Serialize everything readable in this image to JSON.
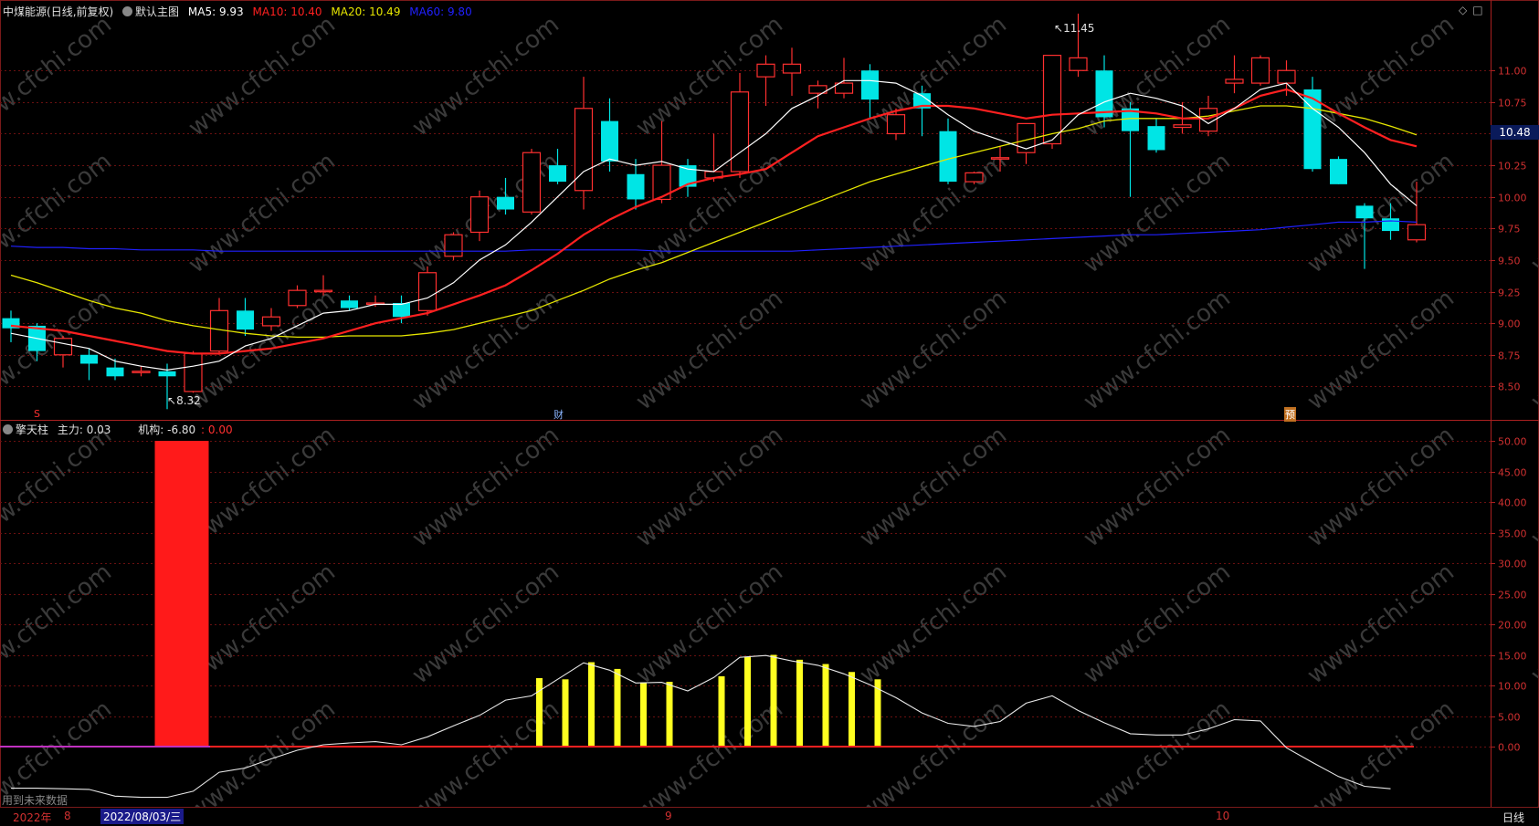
{
  "header": {
    "stock": "中煤能源",
    "mode": "(日线,前复权)",
    "main_chart": "默认主图",
    "ma5_label": "MA5:",
    "ma5": "9.93",
    "ma10_label": "MA10:",
    "ma10": "10.40",
    "ma20_label": "MA20:",
    "ma20": "10.49",
    "ma60_label": "MA60:",
    "ma60": "9.80",
    "colors": {
      "ma5": "#ffffff",
      "ma10": "#ff2020",
      "ma20": "#e6e600",
      "ma60": "#2020ff"
    }
  },
  "sub_header": {
    "indicator": "擎天柱",
    "main_force_label": "主力:",
    "main_force": "0.03",
    "inst_label": "机构:",
    "inst": "-6.80",
    "extra": ": 0.00"
  },
  "markers": {
    "high": "11.45",
    "low": "8.32",
    "ex_div": "S",
    "finance": "财",
    "forecast": "预"
  },
  "current_price": "10.48",
  "bottom_bar": {
    "year": "2022年",
    "date_cursor": "2022/08/03/三",
    "months": [
      "8",
      "9",
      "10"
    ],
    "period": "日线",
    "future_data": "用到未来数据"
  },
  "watermark": "www.cfchi.com",
  "chart_data": [
    {
      "type": "candlestick",
      "title": "中煤能源 (日线,前复权)",
      "ylim": [
        8.25,
        11.5
      ],
      "yticks": [
        8.5,
        8.75,
        9.0,
        9.25,
        9.5,
        9.75,
        10.0,
        10.25,
        10.5,
        10.75,
        11.0
      ],
      "grid": true,
      "candles": [
        {
          "o": 9.04,
          "h": 9.1,
          "l": 8.85,
          "c": 8.96
        },
        {
          "o": 8.98,
          "h": 9.0,
          "l": 8.7,
          "c": 8.78
        },
        {
          "o": 8.75,
          "h": 8.9,
          "l": 8.65,
          "c": 8.88
        },
        {
          "o": 8.75,
          "h": 8.8,
          "l": 8.55,
          "c": 8.68
        },
        {
          "o": 8.65,
          "h": 8.72,
          "l": 8.55,
          "c": 8.58
        },
        {
          "o": 8.62,
          "h": 8.66,
          "l": 8.58,
          "c": 8.62
        },
        {
          "o": 8.62,
          "h": 8.68,
          "l": 8.32,
          "c": 8.58
        },
        {
          "o": 8.46,
          "h": 8.78,
          "l": 8.45,
          "c": 8.76
        },
        {
          "o": 8.78,
          "h": 9.2,
          "l": 8.75,
          "c": 9.1
        },
        {
          "o": 9.1,
          "h": 9.2,
          "l": 8.9,
          "c": 8.95
        },
        {
          "o": 8.98,
          "h": 9.12,
          "l": 8.94,
          "c": 9.05
        },
        {
          "o": 9.14,
          "h": 9.3,
          "l": 9.12,
          "c": 9.26
        },
        {
          "o": 9.26,
          "h": 9.38,
          "l": 9.22,
          "c": 9.26
        },
        {
          "o": 9.18,
          "h": 9.22,
          "l": 9.1,
          "c": 9.12
        },
        {
          "o": 9.16,
          "h": 9.22,
          "l": 9.13,
          "c": 9.16
        },
        {
          "o": 9.16,
          "h": 9.22,
          "l": 9.0,
          "c": 9.05
        },
        {
          "o": 9.1,
          "h": 9.45,
          "l": 9.06,
          "c": 9.4
        },
        {
          "o": 9.53,
          "h": 9.72,
          "l": 9.5,
          "c": 9.7
        },
        {
          "o": 9.72,
          "h": 10.05,
          "l": 9.65,
          "c": 10.0
        },
        {
          "o": 10.0,
          "h": 10.15,
          "l": 9.86,
          "c": 9.9
        },
        {
          "o": 9.88,
          "h": 10.38,
          "l": 9.86,
          "c": 10.35
        },
        {
          "o": 10.25,
          "h": 10.38,
          "l": 10.1,
          "c": 10.12
        },
        {
          "o": 10.05,
          "h": 10.95,
          "l": 9.9,
          "c": 10.7
        },
        {
          "o": 10.6,
          "h": 10.78,
          "l": 10.2,
          "c": 10.28
        },
        {
          "o": 10.18,
          "h": 10.3,
          "l": 9.9,
          "c": 9.98
        },
        {
          "o": 9.98,
          "h": 10.6,
          "l": 9.95,
          "c": 10.25
        },
        {
          "o": 10.25,
          "h": 10.3,
          "l": 10.0,
          "c": 10.08
        },
        {
          "o": 10.15,
          "h": 10.5,
          "l": 10.12,
          "c": 10.2
        },
        {
          "o": 10.2,
          "h": 10.98,
          "l": 10.15,
          "c": 10.83
        },
        {
          "o": 10.95,
          "h": 11.12,
          "l": 10.72,
          "c": 11.05
        },
        {
          "o": 10.98,
          "h": 11.18,
          "l": 10.8,
          "c": 11.05
        },
        {
          "o": 10.82,
          "h": 10.92,
          "l": 10.7,
          "c": 10.88
        },
        {
          "o": 10.82,
          "h": 11.1,
          "l": 10.78,
          "c": 10.9
        },
        {
          "o": 11.0,
          "h": 11.05,
          "l": 10.62,
          "c": 10.77
        },
        {
          "o": 10.5,
          "h": 10.7,
          "l": 10.45,
          "c": 10.65
        },
        {
          "o": 10.82,
          "h": 10.88,
          "l": 10.48,
          "c": 10.7
        },
        {
          "o": 10.52,
          "h": 10.62,
          "l": 10.1,
          "c": 10.12
        },
        {
          "o": 10.12,
          "h": 10.2,
          "l": 10.1,
          "c": 10.19
        },
        {
          "o": 10.3,
          "h": 10.4,
          "l": 10.2,
          "c": 10.31
        },
        {
          "o": 10.35,
          "h": 10.55,
          "l": 10.26,
          "c": 10.58
        },
        {
          "o": 10.42,
          "h": 11.12,
          "l": 10.38,
          "c": 11.12
        },
        {
          "o": 11.0,
          "h": 11.45,
          "l": 10.95,
          "c": 11.1
        },
        {
          "o": 11.0,
          "h": 11.12,
          "l": 10.55,
          "c": 10.63
        },
        {
          "o": 10.7,
          "h": 10.75,
          "l": 10.0,
          "c": 10.52
        },
        {
          "o": 10.56,
          "h": 10.62,
          "l": 10.35,
          "c": 10.37
        },
        {
          "o": 10.55,
          "h": 10.75,
          "l": 10.5,
          "c": 10.57
        },
        {
          "o": 10.52,
          "h": 10.8,
          "l": 10.48,
          "c": 10.7
        },
        {
          "o": 10.9,
          "h": 11.12,
          "l": 10.82,
          "c": 10.93
        },
        {
          "o": 10.9,
          "h": 11.12,
          "l": 10.88,
          "c": 11.1
        },
        {
          "o": 10.9,
          "h": 11.08,
          "l": 10.8,
          "c": 11.0
        },
        {
          "o": 10.85,
          "h": 10.95,
          "l": 10.2,
          "c": 10.22
        },
        {
          "o": 10.3,
          "h": 10.32,
          "l": 10.1,
          "c": 10.1
        },
        {
          "o": 9.93,
          "h": 9.95,
          "l": 9.43,
          "c": 9.83
        },
        {
          "o": 9.83,
          "h": 9.95,
          "l": 9.66,
          "c": 9.73
        },
        {
          "o": 9.66,
          "h": 10.12,
          "l": 9.64,
          "c": 9.78
        }
      ],
      "ma5": [
        8.92,
        8.88,
        8.84,
        8.8,
        8.7,
        8.66,
        8.63,
        8.66,
        8.7,
        8.82,
        8.88,
        8.98,
        9.08,
        9.1,
        9.15,
        9.15,
        9.2,
        9.32,
        9.5,
        9.62,
        9.8,
        10.0,
        10.2,
        10.3,
        10.25,
        10.28,
        10.22,
        10.2,
        10.35,
        10.5,
        10.7,
        10.8,
        10.92,
        10.92,
        10.9,
        10.8,
        10.65,
        10.52,
        10.45,
        10.38,
        10.45,
        10.65,
        10.75,
        10.82,
        10.78,
        10.72,
        10.58,
        10.7,
        10.85,
        10.9,
        10.7,
        10.55,
        10.35,
        10.1,
        9.93
      ],
      "ma10": [
        8.98,
        8.96,
        8.94,
        8.9,
        8.86,
        8.82,
        8.78,
        8.76,
        8.76,
        8.78,
        8.8,
        8.84,
        8.88,
        8.94,
        9.0,
        9.04,
        9.08,
        9.15,
        9.22,
        9.3,
        9.42,
        9.55,
        9.7,
        9.82,
        9.92,
        10.0,
        10.1,
        10.15,
        10.18,
        10.22,
        10.35,
        10.48,
        10.55,
        10.62,
        10.68,
        10.72,
        10.72,
        10.7,
        10.66,
        10.62,
        10.65,
        10.66,
        10.67,
        10.68,
        10.66,
        10.62,
        10.62,
        10.7,
        10.8,
        10.85,
        10.78,
        10.66,
        10.55,
        10.45,
        10.4
      ],
      "ma20": [
        9.38,
        9.32,
        9.25,
        9.18,
        9.12,
        9.08,
        9.02,
        8.98,
        8.95,
        8.92,
        8.9,
        8.89,
        8.89,
        8.9,
        8.9,
        8.9,
        8.92,
        8.95,
        9.0,
        9.05,
        9.1,
        9.18,
        9.26,
        9.35,
        9.42,
        9.48,
        9.56,
        9.64,
        9.72,
        9.8,
        9.88,
        9.96,
        10.04,
        10.12,
        10.18,
        10.24,
        10.3,
        10.35,
        10.4,
        10.45,
        10.5,
        10.54,
        10.6,
        10.62,
        10.62,
        10.62,
        10.64,
        10.68,
        10.72,
        10.72,
        10.7,
        10.66,
        10.62,
        10.56,
        10.49
      ],
      "ma60": [
        9.61,
        9.6,
        9.6,
        9.59,
        9.59,
        9.58,
        9.58,
        9.58,
        9.57,
        9.57,
        9.57,
        9.57,
        9.57,
        9.57,
        9.57,
        9.57,
        9.57,
        9.57,
        9.57,
        9.57,
        9.58,
        9.58,
        9.58,
        9.58,
        9.58,
        9.57,
        9.57,
        9.57,
        9.57,
        9.57,
        9.57,
        9.58,
        9.59,
        9.6,
        9.61,
        9.62,
        9.63,
        9.64,
        9.65,
        9.66,
        9.67,
        9.68,
        9.69,
        9.7,
        9.7,
        9.71,
        9.72,
        9.73,
        9.74,
        9.76,
        9.78,
        9.8,
        9.8,
        9.81,
        9.8
      ]
    },
    {
      "type": "bar",
      "title": "擎天柱",
      "ylim": [
        -7.0,
        50.0
      ],
      "yticks": [
        0.0,
        5.0,
        10.0,
        15.0,
        20.0,
        25.0,
        30.0,
        35.0,
        40.0,
        45.0,
        50.0
      ],
      "grid": true,
      "red_bar": {
        "index": 6,
        "span": 2,
        "value": 50.0
      },
      "yellow_bars": [
        {
          "index": 20,
          "value": 11.2
        },
        {
          "index": 21,
          "value": 11.0
        },
        {
          "index": 22,
          "value": 13.8
        },
        {
          "index": 23,
          "value": 12.7
        },
        {
          "index": 24,
          "value": 10.5
        },
        {
          "index": 25,
          "value": 10.6
        },
        {
          "index": 27,
          "value": 11.5
        },
        {
          "index": 28,
          "value": 14.7
        },
        {
          "index": 29,
          "value": 15.0
        },
        {
          "index": 30,
          "value": 14.2
        },
        {
          "index": 31,
          "value": 13.5
        },
        {
          "index": 32,
          "value": 12.2
        },
        {
          "index": 33,
          "value": 11.0
        }
      ],
      "line": [
        -6.8,
        -6.8,
        -6.9,
        -7.0,
        -8.1,
        -8.3,
        -8.3,
        -7.3,
        -4.2,
        -3.5,
        -2.0,
        -0.6,
        0.3,
        0.6,
        0.8,
        0.3,
        1.6,
        3.4,
        5.1,
        7.6,
        8.3,
        11.0,
        13.7,
        12.5,
        10.4,
        10.5,
        9.1,
        11.3,
        14.6,
        14.9,
        14.0,
        13.3,
        11.9,
        10.1,
        8.0,
        5.5,
        3.8,
        3.3,
        4.1,
        7.1,
        8.3,
        5.9,
        3.9,
        2.1,
        1.9,
        1.9,
        2.9,
        4.4,
        4.2,
        -0.2,
        -2.6,
        -4.9,
        -6.5,
        -6.9
      ]
    }
  ]
}
